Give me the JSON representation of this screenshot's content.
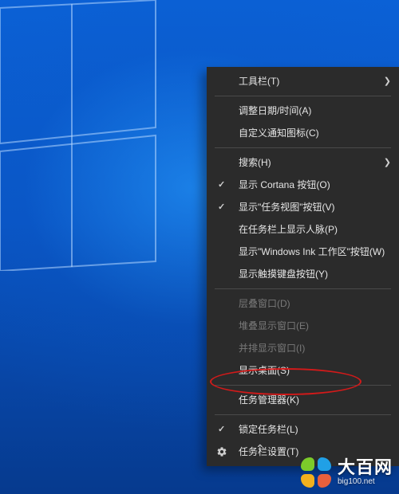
{
  "menu": {
    "toolbar": "工具栏(T)",
    "adjust_datetime": "调整日期/时间(A)",
    "customize_tray": "自定义通知图标(C)",
    "search": "搜索(H)",
    "show_cortana": "显示 Cortana 按钮(O)",
    "show_taskview": "显示\"任务视图\"按钮(V)",
    "show_people": "在任务栏上显示人脉(P)",
    "show_ink": "显示\"Windows Ink 工作区\"按钮(W)",
    "show_touchkb": "显示触摸键盘按钮(Y)",
    "cascade": "层叠窗口(D)",
    "stack": "堆叠显示窗口(E)",
    "sidebyside": "并排显示窗口(I)",
    "show_desktop": "显示桌面(S)",
    "task_manager": "任务管理器(K)",
    "lock_taskbar": "锁定任务栏(L)",
    "taskbar_settings": "任务栏设置(T)"
  },
  "checked": {
    "show_cortana": true,
    "show_taskview": true,
    "lock_taskbar": true
  },
  "watermark": {
    "title": "大百网",
    "url": "big100.net"
  }
}
